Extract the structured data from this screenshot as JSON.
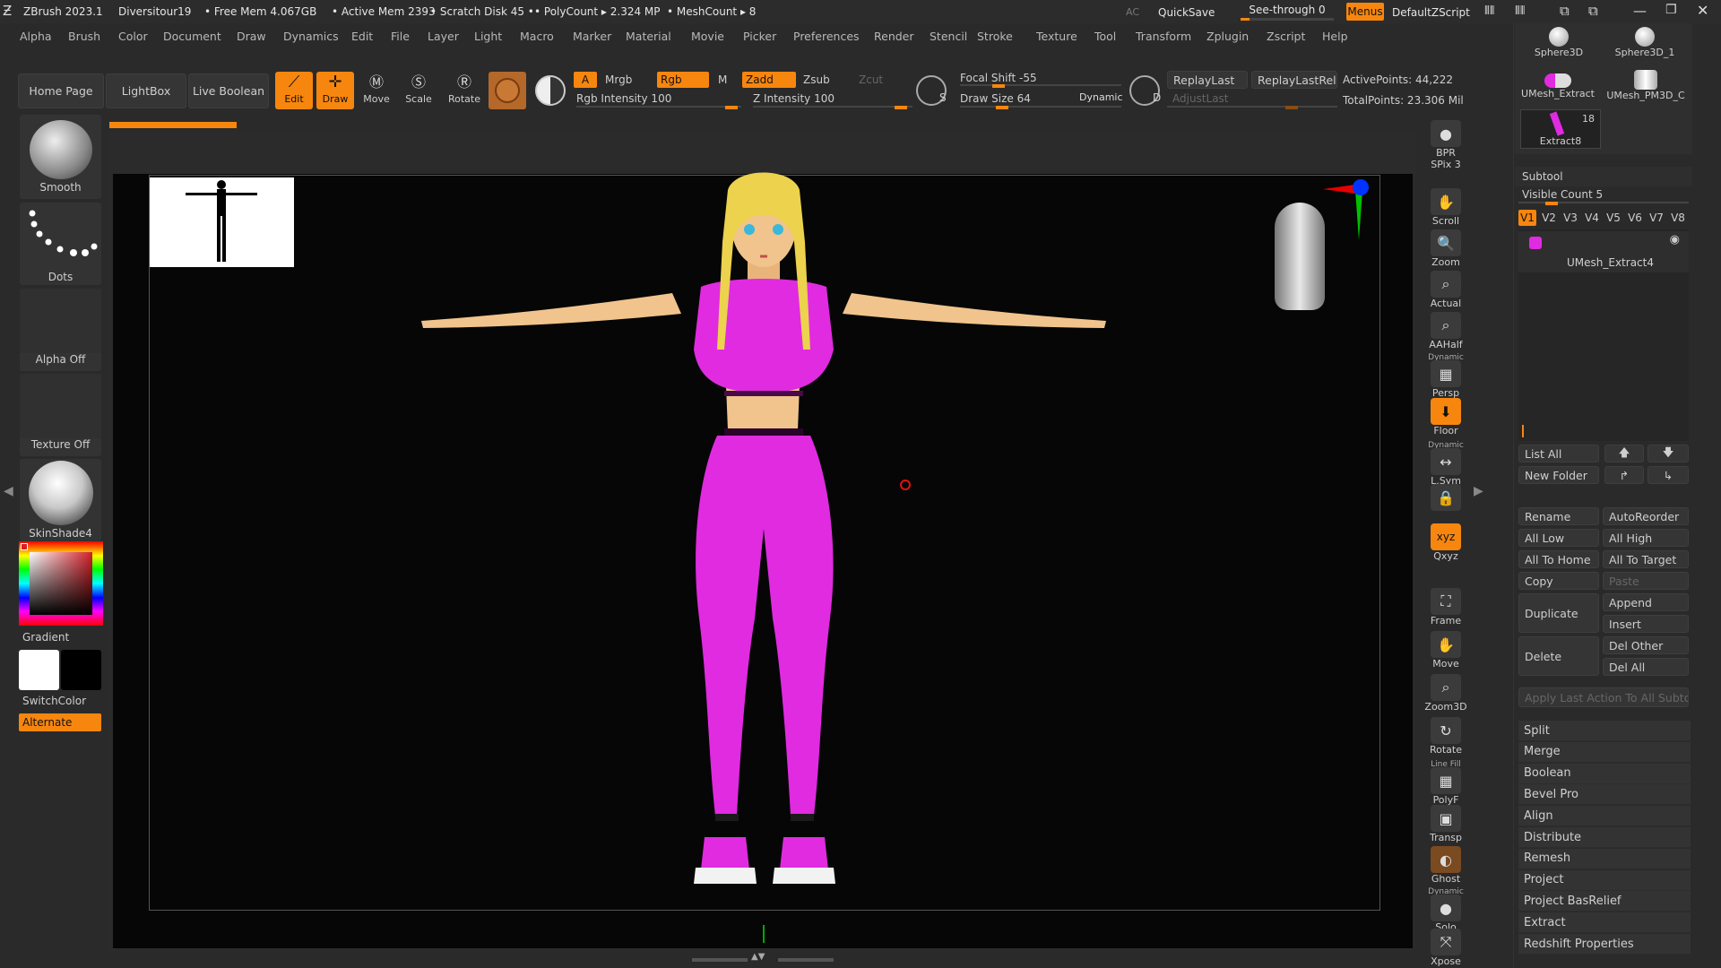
{
  "titlebar": {
    "app": "ZBrush 2023.1",
    "project": "Diversitour19",
    "free_mem": "• Free Mem 4.067GB",
    "active_mem": "• Active Mem 2393",
    "scratch": "• Scratch Disk 45 •",
    "polycount": "• PolyCount ▸ 2.324 MP",
    "meshcount": "• MeshCount ▸ 8",
    "ac": "AC",
    "quicksave": "QuickSave",
    "see_through": "See-through   0",
    "menus": "Menus",
    "zscript": "DefaultZScript"
  },
  "menubar": [
    "Alpha",
    "Brush",
    "Color",
    "Document",
    "Draw",
    "Dynamics",
    "Edit",
    "File",
    "Layer",
    "Light",
    "Macro",
    "Marker",
    "Material",
    "Movie",
    "Picker",
    "Preferences",
    "Render",
    "Stencil",
    "Stroke",
    "Texture",
    "Tool",
    "Transform",
    "Zplugin",
    "Zscript",
    "Help"
  ],
  "toolbar": {
    "home": "Home Page",
    "lightbox": "LightBox",
    "live_boolean": "Live Boolean",
    "edit": "Edit",
    "draw": "Draw",
    "move": "Move",
    "scale": "Scale",
    "rotate": "Rotate",
    "a": "A",
    "mrgb": "Mrgb",
    "rgb": "Rgb",
    "m": "M",
    "zadd": "Zadd",
    "zsub": "Zsub",
    "zcut": "Zcut",
    "rgb_intensity": "Rgb Intensity 100",
    "z_intensity": "Z Intensity 100",
    "focal_shift": "Focal Shift -55",
    "draw_size": "Draw Size 64",
    "dynamic": "Dynamic",
    "replay_last": "ReplayLast",
    "replay_last_rel": "ReplayLastRel",
    "adjust_last": "AdjustLast",
    "active_points": "ActivePoints: 44,222",
    "total_points": "TotalPoints: 23.306 Mil",
    "s_label": "S",
    "d_label": "D"
  },
  "left_shelf": {
    "smooth": "Smooth",
    "dots": "Dots",
    "alpha_off": "Alpha Off",
    "texture_off": "Texture Off",
    "material": "SkinShade4",
    "gradient": "Gradient",
    "switchcolor": "SwitchColor",
    "alternate": "Alternate"
  },
  "right_shelf": [
    {
      "label": "BPR",
      "sub": "SPix 3",
      "icon": "bpr-sphere-icon"
    },
    {
      "label": "Scroll",
      "icon": "scroll-hand-icon"
    },
    {
      "label": "Zoom",
      "icon": "zoom-icon"
    },
    {
      "label": "Actual",
      "icon": "actual-icon"
    },
    {
      "label": "AAHalf",
      "icon": "aahalf-icon"
    },
    {
      "label": "Persp",
      "top": "Dynamic",
      "icon": "persp-icon"
    },
    {
      "label": "Floor",
      "icon": "floor-icon"
    },
    {
      "label": "L.Sym",
      "top": "Dynamic",
      "icon": "lsym-icon"
    },
    {
      "label": "",
      "icon": "lock-icon"
    },
    {
      "label": "Qxyz",
      "icon": "xyz-icon"
    },
    {
      "label": "Frame",
      "icon": "frame-icon"
    },
    {
      "label": "Move",
      "icon": "move-hand-icon"
    },
    {
      "label": "Zoom3D",
      "icon": "zoom3d-icon"
    },
    {
      "label": "Rotate",
      "icon": "rotate-icon"
    },
    {
      "label": "PolyF",
      "top": "Line Fill",
      "icon": "polyf-icon"
    },
    {
      "label": "Transp",
      "icon": "transp-icon"
    },
    {
      "label": "Ghost",
      "icon": "ghost-icon"
    },
    {
      "label": "Solo",
      "top": "Dynamic",
      "icon": "solo-icon"
    },
    {
      "label": "Xpose",
      "icon": "xpose-icon"
    }
  ],
  "tool_thumbs": {
    "t1": "Sphere3D",
    "t2": "Sphere3D_1",
    "t3": "UMesh_Extract",
    "t4": "UMesh_PM3D_C",
    "t5": "Extract8",
    "count": "18"
  },
  "subtool": {
    "title": "Subtool",
    "visible_count": "Visible Count 5",
    "versions": [
      "V1",
      "V2",
      "V3",
      "V4",
      "V5",
      "V6",
      "V7",
      "V8"
    ],
    "item": "UMesh_Extract4",
    "list_all": "List All",
    "new_folder": "New Folder",
    "rename": "Rename",
    "autoreorder": "AutoReorder",
    "all_low": "All Low",
    "all_high": "All High",
    "all_to_home": "All To Home",
    "all_to_target": "All To Target",
    "copy": "Copy",
    "paste": "Paste",
    "duplicate": "Duplicate",
    "append": "Append",
    "insert": "Insert",
    "delete": "Delete",
    "del_other": "Del Other",
    "del_all": "Del All",
    "apply_last": "Apply Last Action To All Subtools"
  },
  "deformers": [
    "Split",
    "Merge",
    "Boolean",
    "Bevel Pro",
    "Align",
    "Distribute",
    "Remesh",
    "Project",
    "Project BasRelief",
    "Extract",
    "Redshift Properties"
  ],
  "colors": {
    "accent": "#f7860f",
    "outfit": "#e02be0",
    "hair": "#ecd24d",
    "skin": "#f0c48c"
  }
}
